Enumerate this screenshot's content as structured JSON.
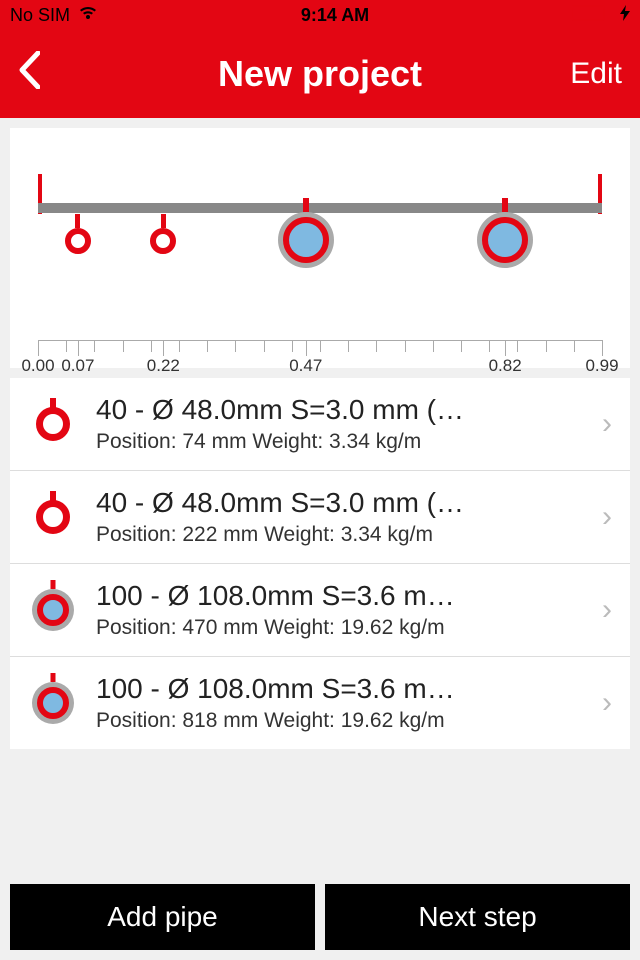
{
  "statusbar": {
    "carrier": "No SIM",
    "time": "9:14 AM"
  },
  "navbar": {
    "title": "New project",
    "edit": "Edit"
  },
  "chart_data": {
    "type": "scatter",
    "title": "",
    "xlabel": "",
    "ylabel": "",
    "xlim": [
      0,
      0.99
    ],
    "ticks_at": [
      0.0,
      0.07,
      0.22,
      0.47,
      0.82,
      0.99
    ],
    "tick_labels": [
      "0.00",
      "0.07",
      "0.22",
      "0.47",
      "0.82",
      "0.99"
    ],
    "markers": [
      {
        "x": 0.07,
        "size": "small"
      },
      {
        "x": 0.22,
        "size": "small"
      },
      {
        "x": 0.47,
        "size": "large"
      },
      {
        "x": 0.82,
        "size": "large"
      }
    ]
  },
  "pipes": [
    {
      "icon": "small",
      "title": "40 - Ø 48.0mm S=3.0 mm (…",
      "subtitle": "Position:  74 mm  Weight: 3.34 kg/m"
    },
    {
      "icon": "small",
      "title": "40 - Ø 48.0mm S=3.0 mm (…",
      "subtitle": "Position:  222 mm  Weight: 3.34 kg/m"
    },
    {
      "icon": "large",
      "title": "100 - Ø 108.0mm S=3.6 m…",
      "subtitle": "Position:  470 mm  Weight: 19.62 kg/m"
    },
    {
      "icon": "large",
      "title": "100 - Ø 108.0mm S=3.6 m…",
      "subtitle": "Position:  818 mm  Weight: 19.62 kg/m"
    }
  ],
  "buttons": {
    "add": "Add pipe",
    "next": "Next step"
  }
}
